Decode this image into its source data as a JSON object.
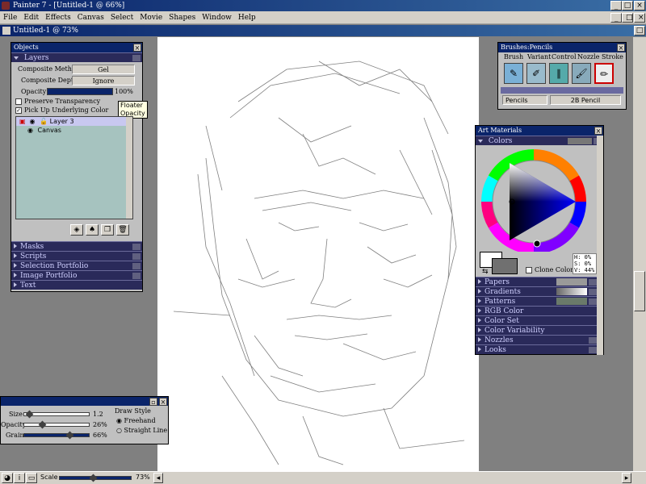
{
  "app": {
    "title": "Painter 7 - [Untitled-1 @ 66%]",
    "doc_title": "Untitled-1 @ 73%"
  },
  "menu": [
    "File",
    "Edit",
    "Effects",
    "Canvas",
    "Select",
    "Movie",
    "Shapes",
    "Window",
    "Help"
  ],
  "objects_palette": {
    "title": "Objects",
    "layers_label": "Layers",
    "composite_method_label": "Composite Method",
    "composite_method_value": "Gel",
    "composite_depth_label": "Composite Depth",
    "composite_depth_value": "Ignore",
    "opacity_label": "Opacity",
    "opacity_value": "100%",
    "preserve_transparency": "Preserve Transparency",
    "pick_up_color": "Pick Up Underlying Color",
    "tooltip": "Floater Opacity",
    "layers": [
      {
        "name": "Layer 3",
        "selected": true
      },
      {
        "name": "Canvas",
        "selected": false
      }
    ],
    "sections": [
      "Masks",
      "Scripts",
      "Selection Portfolio",
      "Image Portfolio",
      "Text"
    ]
  },
  "brushes_palette": {
    "title": "Brushes:Pencils",
    "tabs": [
      "Brush",
      "Variant",
      "Control",
      "Nozzle",
      "Stroke"
    ],
    "category": "Pencils",
    "variant": "2B Pencil"
  },
  "art_materials": {
    "title": "Art Materials",
    "colors_label": "Colors",
    "hsv": {
      "h": "H:   0%",
      "s": "S:   0%",
      "v": "V:  44%"
    },
    "clone_color": "Clone Color",
    "sections": [
      "Papers",
      "Gradients",
      "Patterns",
      "RGB Color",
      "Color Set",
      "Color Variability",
      "Nozzles",
      "Looks"
    ]
  },
  "controls_palette": {
    "size_label": "Size",
    "size_value": "1.2",
    "opacity_label": "Opacity",
    "opacity_value": "26%",
    "grain_label": "Grain",
    "grain_value": "66%",
    "draw_style_label": "Draw Style",
    "freehand": "Freehand",
    "straight_line": "Straight Line"
  },
  "status": {
    "scale_label": "Scale",
    "scale_value": "73%"
  },
  "colors": {
    "title_bar": "#0a246a",
    "layer_list_bg": "#a6c3bf",
    "section_bar": "#2a2a5a"
  }
}
